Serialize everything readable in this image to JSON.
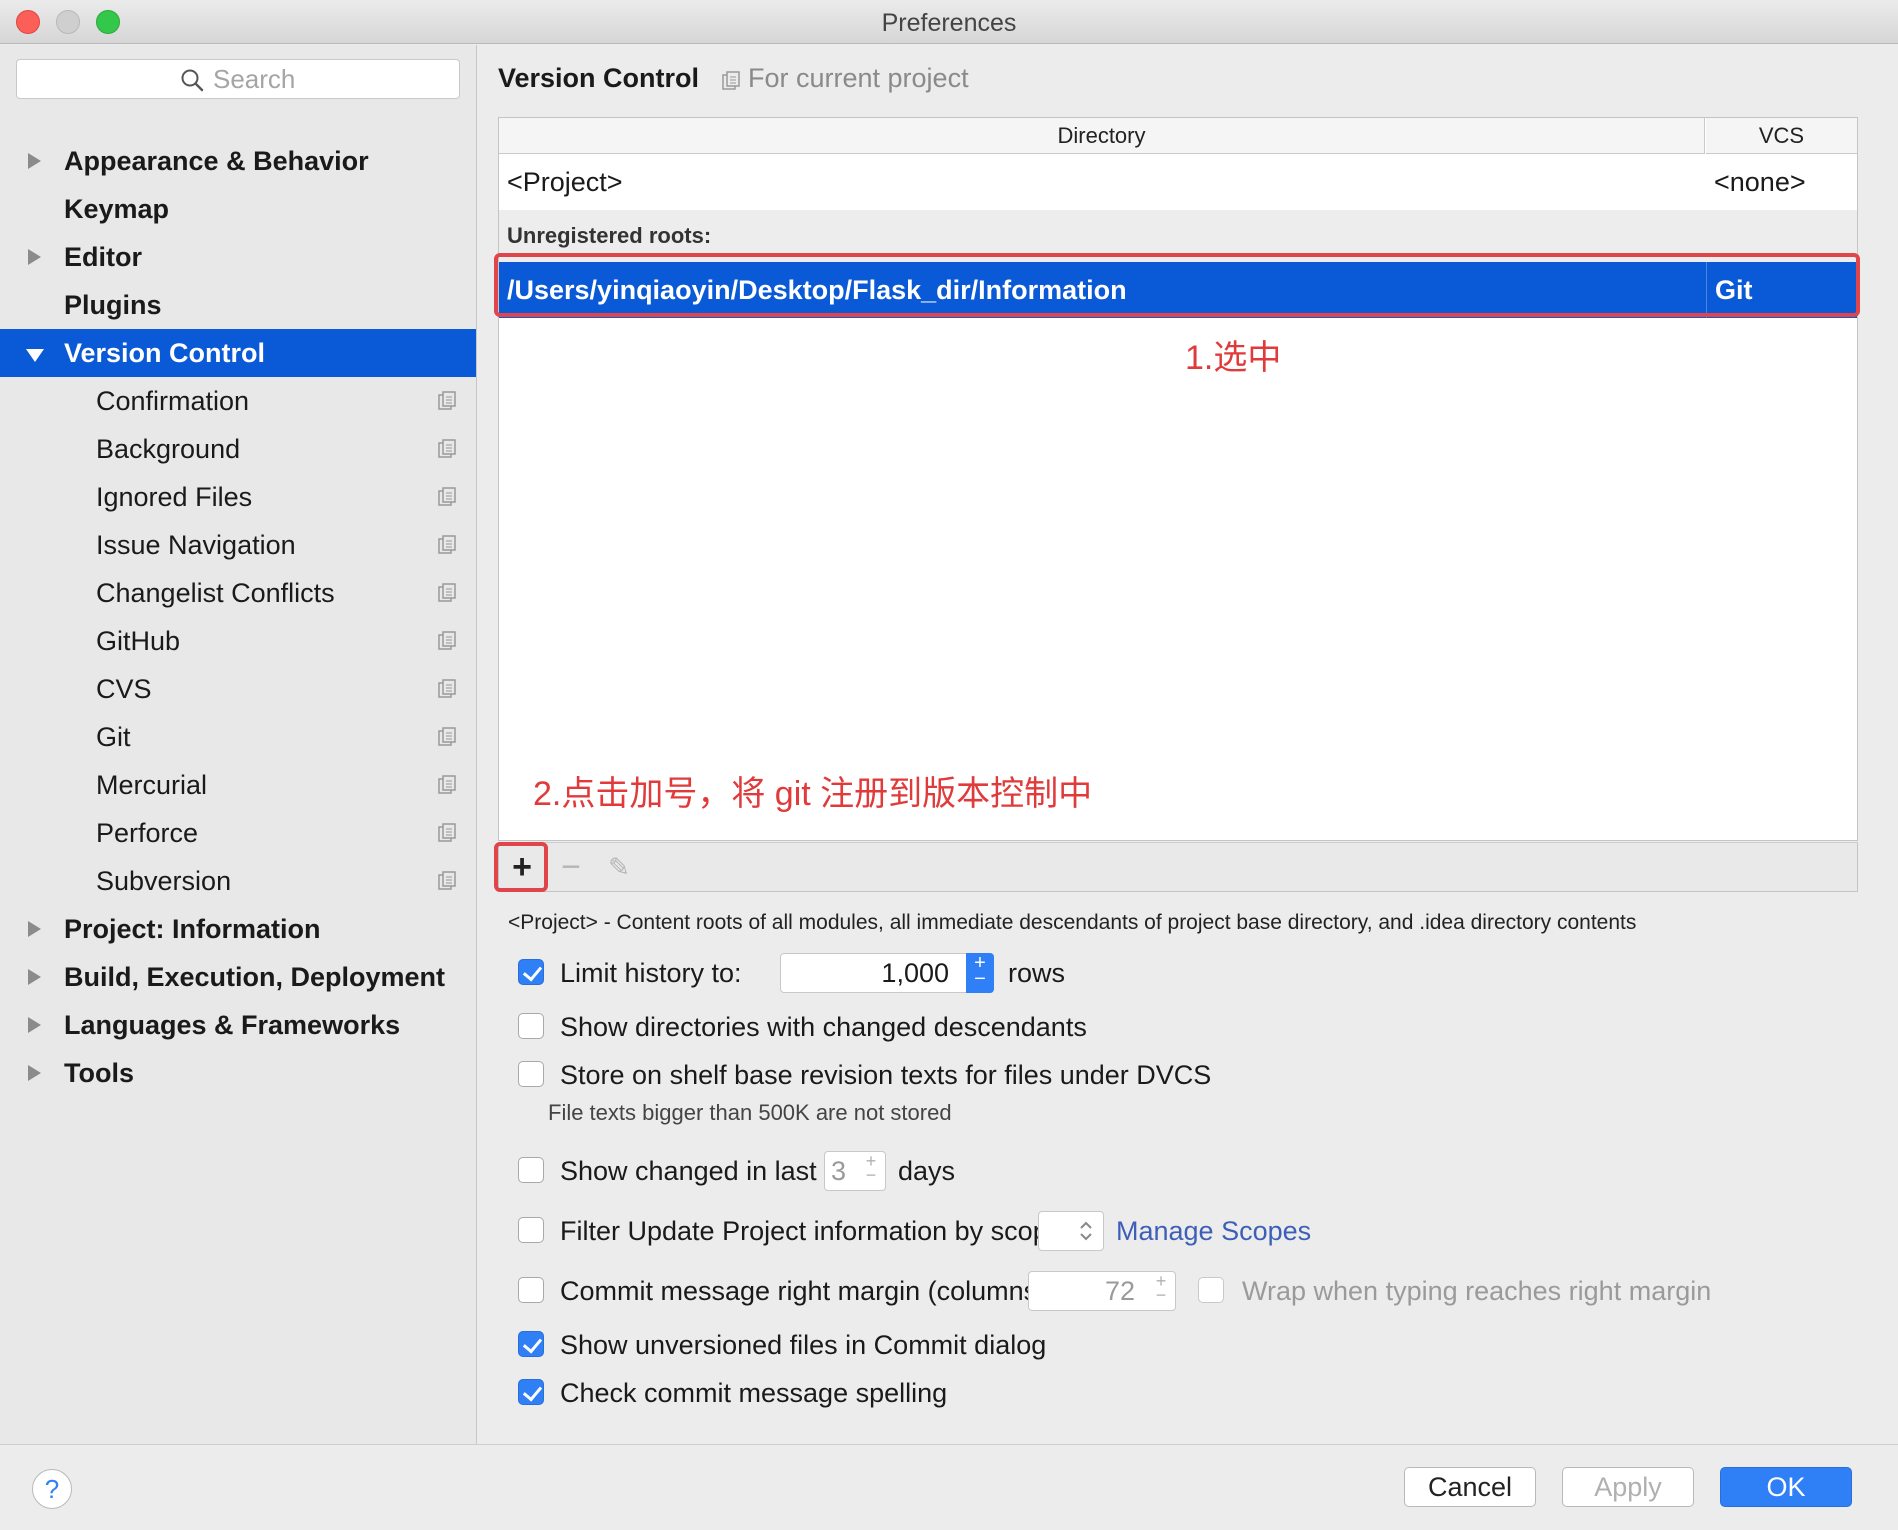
{
  "window": {
    "title": "Preferences"
  },
  "sidebar": {
    "search_placeholder": "Search",
    "items": [
      {
        "label": "Appearance & Behavior",
        "level": 0,
        "expandable": true
      },
      {
        "label": "Keymap",
        "level": 0,
        "expandable": false
      },
      {
        "label": "Editor",
        "level": 0,
        "expandable": true
      },
      {
        "label": "Plugins",
        "level": 0,
        "expandable": false
      },
      {
        "label": "Version Control",
        "level": 0,
        "expanded": true,
        "selected": true
      },
      {
        "label": "Confirmation",
        "level": 1
      },
      {
        "label": "Background",
        "level": 1
      },
      {
        "label": "Ignored Files",
        "level": 1
      },
      {
        "label": "Issue Navigation",
        "level": 1
      },
      {
        "label": "Changelist Conflicts",
        "level": 1
      },
      {
        "label": "GitHub",
        "level": 1
      },
      {
        "label": "CVS",
        "level": 1
      },
      {
        "label": "Git",
        "level": 1
      },
      {
        "label": "Mercurial",
        "level": 1
      },
      {
        "label": "Perforce",
        "level": 1
      },
      {
        "label": "Subversion",
        "level": 1
      },
      {
        "label": "Project: Information",
        "level": 0,
        "expandable": true
      },
      {
        "label": "Build, Execution, Deployment",
        "level": 0,
        "expandable": true
      },
      {
        "label": "Languages & Frameworks",
        "level": 0,
        "expandable": true
      },
      {
        "label": "Tools",
        "level": 0,
        "expandable": true
      }
    ]
  },
  "header": {
    "title": "Version Control",
    "scope": "For current project"
  },
  "table": {
    "columns": [
      "Directory",
      "VCS"
    ],
    "project_row": {
      "directory": "<Project>",
      "vcs": "<none>"
    },
    "section_label": "Unregistered roots:",
    "selected_row": {
      "directory": "/Users/yinqiaoyin/Desktop/Flask_dir/Information",
      "vcs": "Git"
    }
  },
  "annotations": {
    "step1": "1.选中",
    "step2": "2.点击加号，将 git 注册到版本控制中"
  },
  "toolbar": {
    "add": "+",
    "remove": "−",
    "edit": "✎"
  },
  "note": "<Project> - Content roots of all modules, all immediate descendants of project base directory, and .idea directory contents",
  "options": {
    "limit_history": {
      "label": "Limit history to:",
      "checked": true,
      "value": "1,000",
      "unit": "rows"
    },
    "show_dirs": {
      "label": "Show directories with changed descendants",
      "checked": false
    },
    "store_shelf": {
      "label": "Store on shelf base revision texts for files under DVCS",
      "checked": false,
      "helper": "File texts bigger than 500K are not stored"
    },
    "show_changed": {
      "label": "Show changed in last",
      "checked": false,
      "value": "3",
      "unit": "days"
    },
    "filter_update": {
      "label": "Filter Update Project information by scope",
      "checked": false,
      "link": "Manage Scopes"
    },
    "commit_margin": {
      "label": "Commit message right margin (columns):",
      "checked": false,
      "value": "72",
      "wrap_label": "Wrap when typing reaches right margin",
      "wrap_checked": false
    },
    "show_unversioned": {
      "label": "Show unversioned files in Commit dialog",
      "checked": true
    },
    "check_spelling": {
      "label": "Check commit message spelling",
      "checked": true
    }
  },
  "footer": {
    "help": "?",
    "cancel": "Cancel",
    "apply": "Apply",
    "ok": "OK"
  },
  "colors": {
    "selection": "#0a59d6",
    "accent": "#2f7ff7",
    "annotation": "#e0454b",
    "link": "#3d5fb8"
  }
}
